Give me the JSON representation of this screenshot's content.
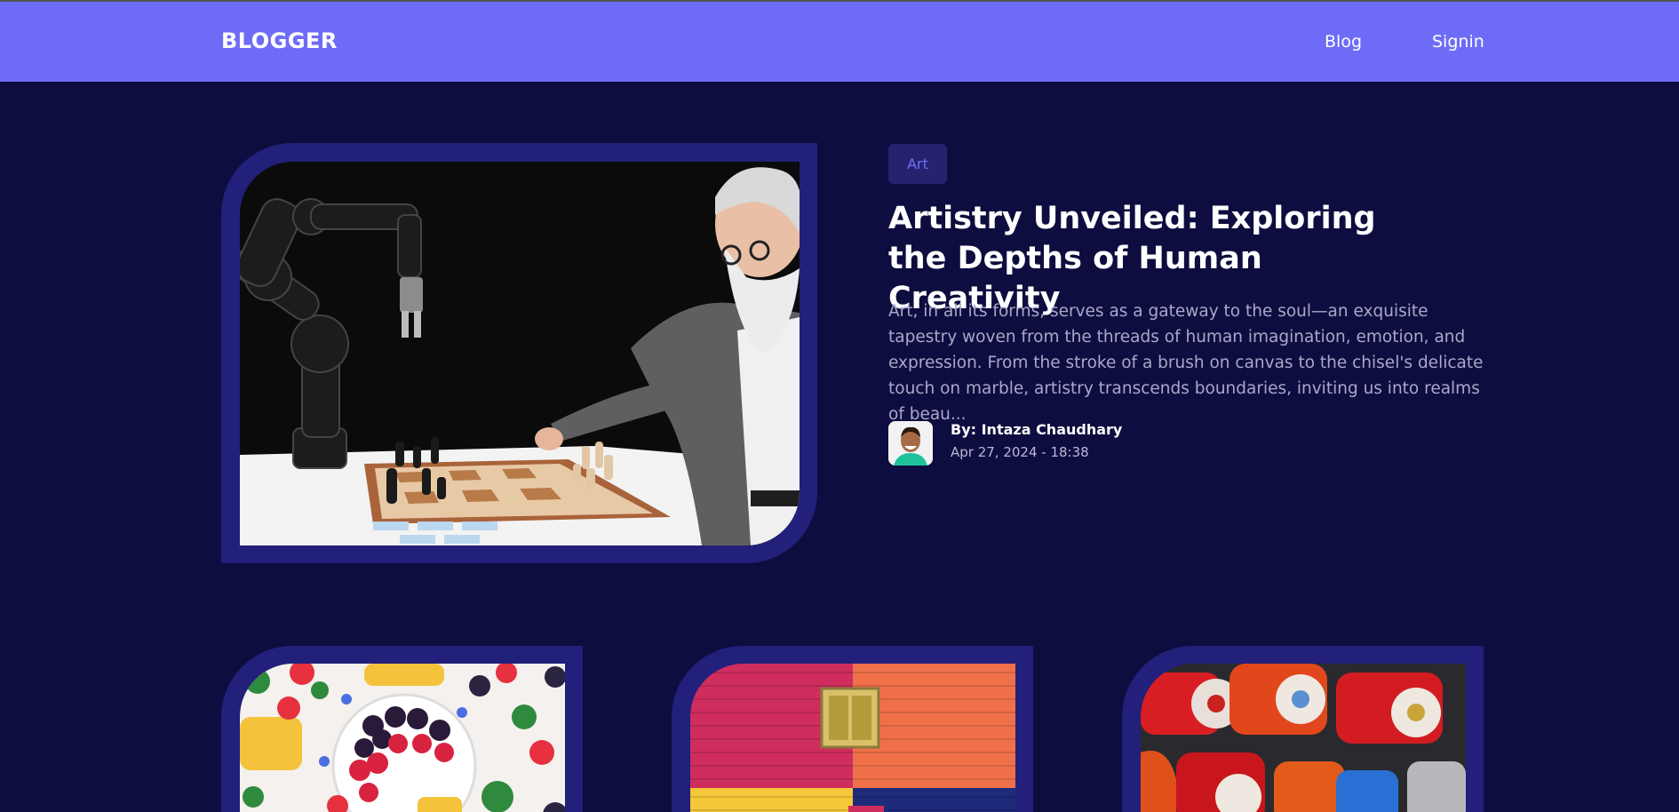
{
  "header": {
    "logo": "BLOGGER",
    "nav": [
      {
        "label": "Blog"
      },
      {
        "label": "Signin"
      }
    ]
  },
  "featured": {
    "category": "Art",
    "title": "Artistry Unveiled: Exploring the Depths of Human Creativity",
    "excerpt": "Art, in all its forms, serves as a gateway to the soul—an exquisite tapestry woven from the threads of human imagination, emotion, and expression. From the stroke of a brush on canvas to the chisel's delicate touch on marble, artistry transcends boundaries, inviting us into realms of beau...",
    "author": "By: Intaza Chaudhary",
    "date": "Apr 27, 2024 - 18:38",
    "image": "robot-arm-playing-chess-with-old-man"
  },
  "cards": [
    {
      "image": "fruit-bowl-with-berries"
    },
    {
      "image": "colorful-wall-with-yellow-window"
    },
    {
      "image": "red-rotary-telephones"
    }
  ],
  "colors": {
    "background": "#0e0d3f",
    "navbar": "#6e6cf7",
    "frame": "#22207a",
    "badge_bg": "#25236f",
    "badge_text": "#7471f7"
  }
}
